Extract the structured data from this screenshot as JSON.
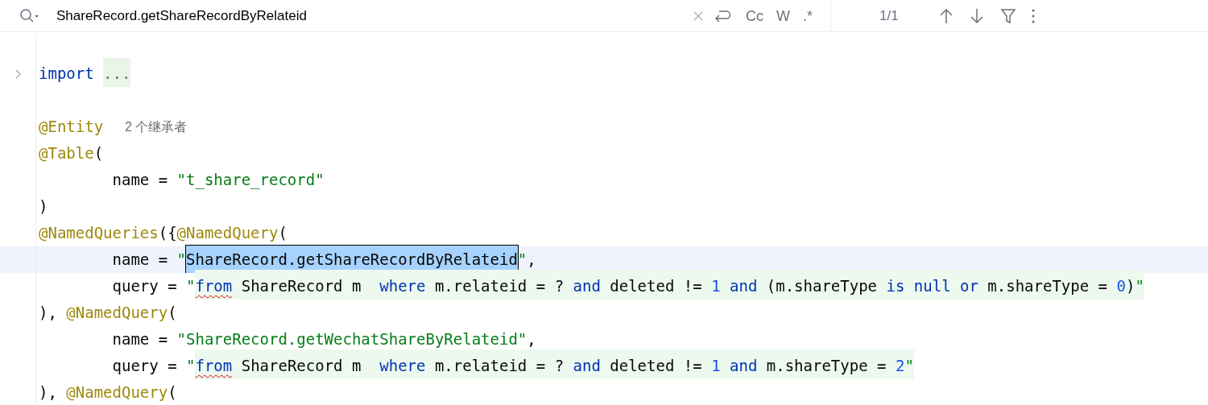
{
  "search_bar": {
    "query": "ShareRecord.getShareRecordByRelateid",
    "toggles": [
      {
        "label": "Cc",
        "selected": false
      },
      {
        "label": "W",
        "selected": false
      },
      {
        "label": ".*",
        "selected": false
      }
    ],
    "match_count": "1/1"
  },
  "editor": {
    "lines": [
      {
        "current": false,
        "collapsed": false
      },
      {
        "current": false,
        "collapsed": true,
        "tokens": [
          {
            "kind": "keyword",
            "text": "import "
          },
          {
            "kind": "folded",
            "text": "..."
          }
        ]
      },
      {
        "current": false,
        "collapsed": false
      },
      {
        "current": false,
        "collapsed": false,
        "tokens": [
          {
            "kind": "annotation",
            "text": "@Entity  "
          },
          {
            "kind": "hint",
            "text": "2 个继承者"
          }
        ]
      },
      {
        "current": false,
        "collapsed": false,
        "tokens": [
          {
            "kind": "annotation",
            "text": "@Table"
          },
          {
            "kind": "plain",
            "text": "("
          }
        ]
      },
      {
        "current": false,
        "collapsed": false,
        "tokens": [
          {
            "kind": "plain",
            "text": "        name = "
          },
          {
            "kind": "string",
            "text": "\"t_share_record\""
          }
        ]
      },
      {
        "current": false,
        "collapsed": false,
        "tokens": [
          {
            "kind": "plain",
            "text": ")"
          }
        ]
      },
      {
        "current": false,
        "collapsed": false,
        "tokens": [
          {
            "kind": "annotation",
            "text": "@NamedQueries"
          },
          {
            "kind": "plain",
            "text": "({"
          },
          {
            "kind": "annotation",
            "text": "@NamedQuery"
          },
          {
            "kind": "plain",
            "text": "("
          }
        ]
      },
      {
        "current": true,
        "collapsed": false,
        "tokens": [
          {
            "kind": "plain",
            "text": "        name = "
          },
          {
            "kind": "string",
            "text": "\""
          },
          {
            "kind": "match",
            "text": "ShareRecord.getShareRecordByRelateid"
          },
          {
            "kind": "string",
            "text": "\""
          },
          {
            "kind": "plain",
            "text": ","
          }
        ]
      },
      {
        "current": false,
        "collapsed": false,
        "tokens": [
          {
            "kind": "plain",
            "text": "        query = "
          },
          {
            "kind": "string",
            "text": "\""
          },
          {
            "kind": "injection",
            "children": [
              {
                "kind": "error_keyword",
                "text": "from"
              },
              {
                "kind": "plain",
                "text": " ShareRecord m  "
              },
              {
                "kind": "keyword",
                "text": "where"
              },
              {
                "kind": "plain",
                "text": " m.relateid = ? "
              },
              {
                "kind": "keyword",
                "text": "and"
              },
              {
                "kind": "plain",
                "text": " deleted != "
              },
              {
                "kind": "number",
                "text": "1 "
              },
              {
                "kind": "keyword",
                "text": "and"
              },
              {
                "kind": "plain",
                "text": " (m.shareType "
              },
              {
                "kind": "keyword",
                "text": "is null or"
              },
              {
                "kind": "plain",
                "text": " m.shareType = "
              },
              {
                "kind": "number",
                "text": "0"
              },
              {
                "kind": "plain",
                "text": ")"
              },
              {
                "kind": "string",
                "text": "\""
              }
            ]
          }
        ]
      },
      {
        "current": false,
        "collapsed": false,
        "tokens": [
          {
            "kind": "plain",
            "text": "), "
          },
          {
            "kind": "annotation",
            "text": "@NamedQuery"
          },
          {
            "kind": "plain",
            "text": "("
          }
        ]
      },
      {
        "current": false,
        "collapsed": false,
        "tokens": [
          {
            "kind": "plain",
            "text": "        name = "
          },
          {
            "kind": "string",
            "text": "\"ShareRecord.getWechatShareByRelateid\""
          },
          {
            "kind": "plain",
            "text": ","
          }
        ]
      },
      {
        "current": false,
        "collapsed": false,
        "tokens": [
          {
            "kind": "plain",
            "text": "        query = "
          },
          {
            "kind": "string",
            "text": "\""
          },
          {
            "kind": "injection",
            "children": [
              {
                "kind": "error_keyword",
                "text": "from"
              },
              {
                "kind": "plain",
                "text": " ShareRecord m  "
              },
              {
                "kind": "keyword",
                "text": "where"
              },
              {
                "kind": "plain",
                "text": " m.relateid = ? "
              },
              {
                "kind": "keyword",
                "text": "and"
              },
              {
                "kind": "plain",
                "text": " deleted != "
              },
              {
                "kind": "number",
                "text": "1 "
              },
              {
                "kind": "keyword",
                "text": "and"
              },
              {
                "kind": "plain",
                "text": " m.shareType = "
              },
              {
                "kind": "number",
                "text": "2"
              },
              {
                "kind": "string",
                "text": "\""
              }
            ]
          }
        ]
      },
      {
        "current": false,
        "collapsed": false,
        "tokens": [
          {
            "kind": "plain",
            "text": "), "
          },
          {
            "kind": "annotation",
            "text": "@NamedQuery"
          },
          {
            "kind": "plain",
            "text": "("
          }
        ]
      }
    ]
  }
}
